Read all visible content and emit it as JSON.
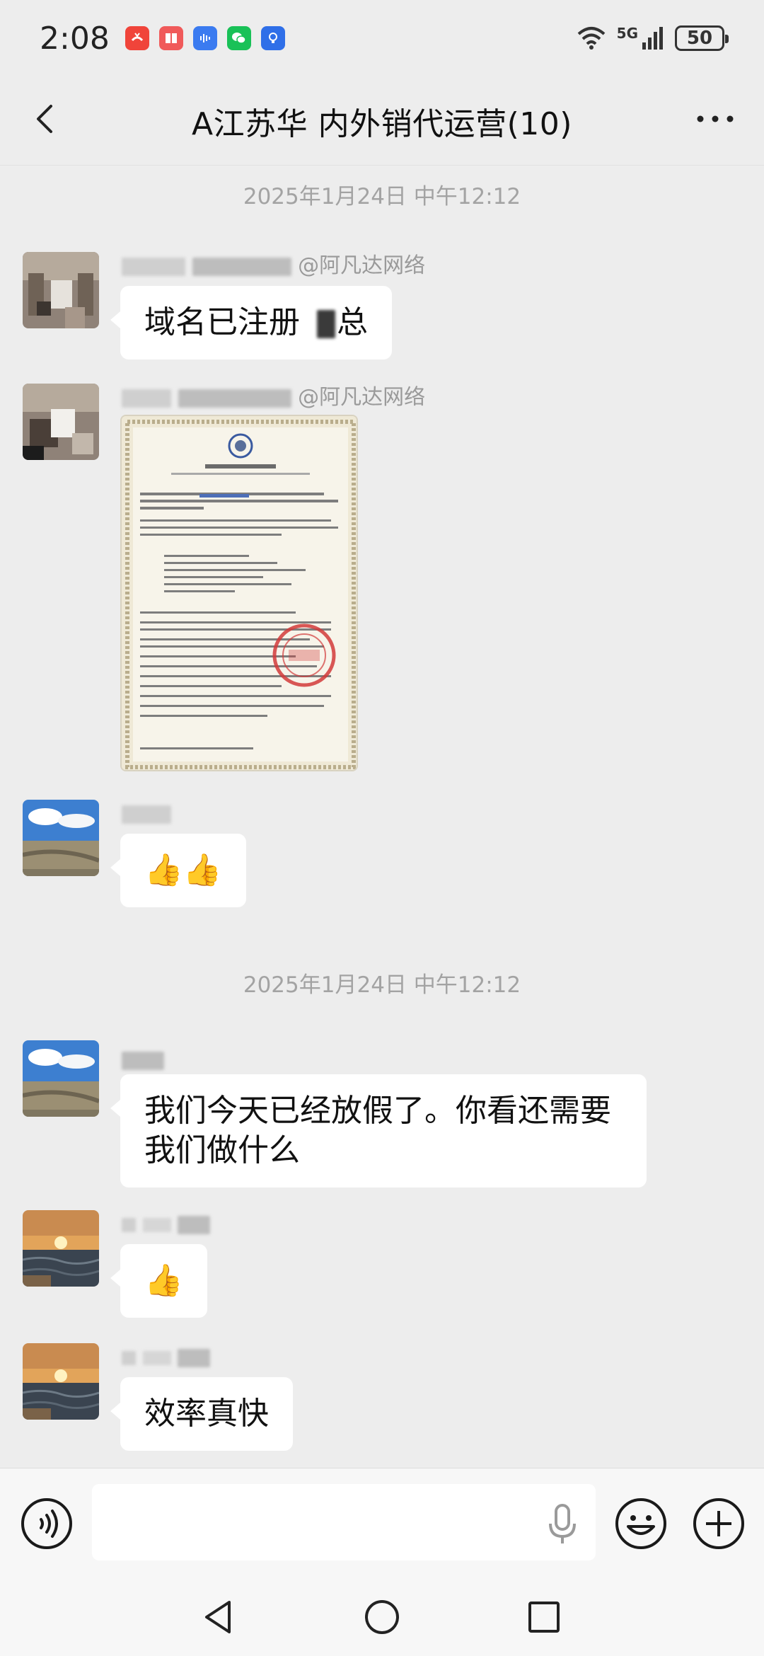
{
  "status_bar": {
    "time": "2:08",
    "network": "5G",
    "battery": "50",
    "app_icons": [
      "call-missed-icon",
      "book-app-icon",
      "voice-app-icon",
      "wechat-icon",
      "notification-bulb-icon"
    ]
  },
  "header": {
    "title": "A江苏华 内外销代运营(10)"
  },
  "timestamps": {
    "first": "2025年1月24日 中午12:12",
    "second": "2025年1月24日 中午12:12"
  },
  "messages": [
    {
      "sender": "@阿凡达网络",
      "text": "域名已注册",
      "text_suffix": "总"
    },
    {
      "sender": "@阿凡达网络",
      "image": "certificate-image"
    },
    {
      "sender": "",
      "text": "👍👍"
    },
    {
      "sender": "",
      "text_line1": "我们今天已经放假了。你看还需要",
      "text_line2": "我们做什么"
    },
    {
      "sender": "",
      "text": "👍"
    },
    {
      "sender": "",
      "text": "效率真快"
    }
  ],
  "input": {
    "placeholder": ""
  },
  "colors": {
    "background": "#ededed",
    "bubble": "#ffffff",
    "timestamp": "#a3a3a3",
    "sender": "#9a9a9a",
    "stamp_red": "#d23a3a"
  }
}
